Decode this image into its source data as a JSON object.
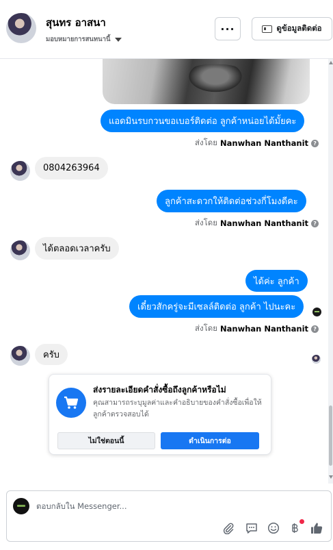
{
  "header": {
    "contact_name": "สุนทร อาสนา",
    "assign_label": "มอบหมายการสนทนานี้",
    "more_label": "···",
    "contact_info_label": "ดูข้อมูลติดต่อ"
  },
  "messages": [
    {
      "text": "แอดมินรบกวนขอเบอร์ติดต่อ ลูกค้าหน่อยได้มั้ยคะ"
    },
    {
      "text": "0804263964"
    },
    {
      "text": "ลูกค้าสะดวกให้ติดต่อช่วงกี่โมงดีคะ"
    },
    {
      "text": "ได้ตลอดเวลาครับ"
    },
    {
      "text": "ได้ค่ะ  ลูกค้า"
    },
    {
      "text": "เดี๋ยวสักครู่จะมีเซลล์ติดต่อ ลูกค้า ไปนะคะ"
    },
    {
      "text": "ครับ"
    }
  ],
  "sent_by": {
    "prefix": "ส่งโดย",
    "name": "Nanwhan Nanthanit"
  },
  "order_prompt": {
    "title": "ส่งรายละเอียดคำสั่งซื้อถึงลูกค้าหรือไม่",
    "description": "คุณสามารถระบุมูลค่าและคำอธิบายของคำสั่งซื้อเพื่อให้ลูกค้าตรวจสอบได้",
    "decline_label": "ไม่ใช่ตอนนี้",
    "continue_label": "ดำเนินการต่อ"
  },
  "composer": {
    "placeholder": "ตอบกลับใน Messenger..."
  },
  "colors": {
    "outgoing_bubble": "#0084ff",
    "incoming_bubble": "#f0f0f0",
    "primary_button": "#1877f2",
    "notification_dot": "#f02849"
  }
}
